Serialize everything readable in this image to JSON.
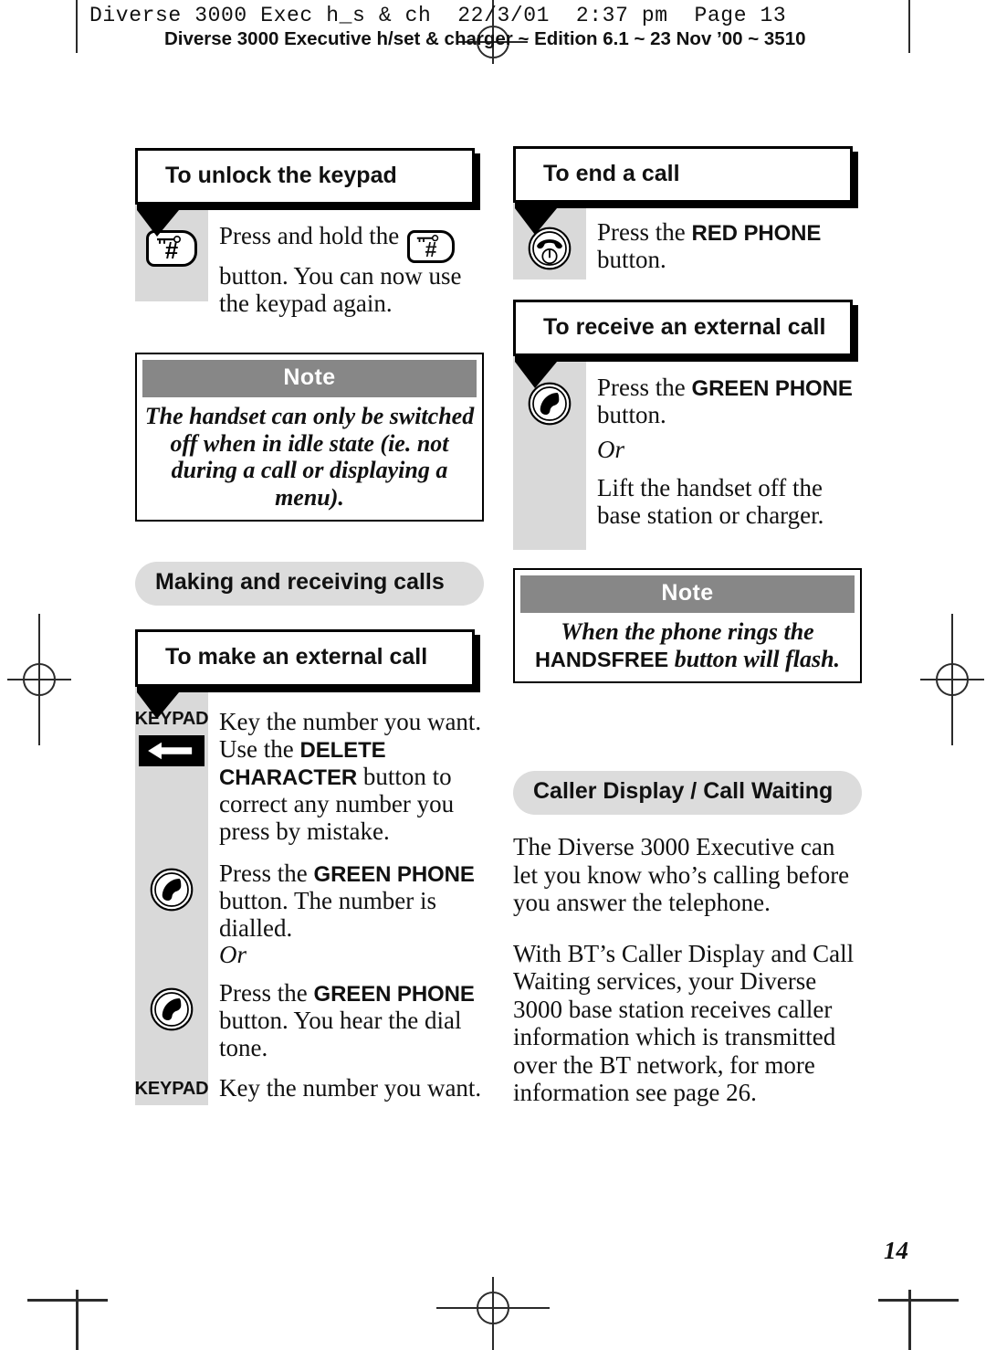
{
  "header": {
    "mono_line": "Diverse 3000 Exec h_s & ch  22/3/01  2:37 pm  Page 13",
    "sans_line": "Diverse 3000 Executive h/set & charger ~ Edition 6.1 ~ 23 Nov ’00 ~ 3510"
  },
  "left_column": {
    "unlock": {
      "heading": "To unlock the keypad",
      "step_text_a": "Press and hold the ",
      "step_text_b": " button. You can now use the keypad again."
    },
    "note": {
      "label": "Note",
      "body": "The handset can only be switched off when in idle state (ie. not during a call or displaying a menu)."
    },
    "section_pill": "Making and receiving calls",
    "make_call": {
      "heading": "To make an external call",
      "keypad_label_1": "KEYPAD",
      "step1_a": "Key the number you want. Use the ",
      "step1_bold1": "DELETE CHARACTER",
      "step1_b": " button to correct any number you press by mistake.",
      "step2_a": "Press the ",
      "step2_bold": "GREEN PHONE",
      "step2_b": " button. The number is dialled.",
      "or": "Or",
      "step3_a": "Press the ",
      "step3_bold": "GREEN PHONE",
      "step3_b": " button. You hear the dial tone.",
      "keypad_label_2": "KEYPAD",
      "step4": "Key the number you want."
    }
  },
  "right_column": {
    "end_call": {
      "heading": "To end a call",
      "step_a": "Press the ",
      "step_bold": "RED PHONE",
      "step_b": " button."
    },
    "receive_call": {
      "heading": "To receive an external call",
      "step1_a": "Press the ",
      "step1_bold": "GREEN PHONE",
      "step1_b": " button.",
      "or": "Or",
      "step2": "Lift the handset off the base station or charger."
    },
    "note": {
      "label": "Note",
      "body_a": "When the phone rings the ",
      "body_bold": "HANDSFREE",
      "body_b": " button will flash."
    },
    "caller_display": {
      "pill": "Caller Display / Call Waiting",
      "para1": "The Diverse 3000 Executive can let you know who’s calling before you answer the telephone.",
      "para2": "With BT’s Caller Display and Call Waiting services, your Diverse 3000 base station receives caller information which is transmitted over the BT network, for more information see page 26."
    }
  },
  "footer": {
    "page_number": "14"
  },
  "icons": {
    "hash_button": "hash-key-button-icon",
    "green_phone": "green-phone-icon",
    "red_phone": "red-phone-icon",
    "delete_character": "delete-character-arrow-icon"
  },
  "colors": {
    "gutter_grey": "#d9d9d9",
    "note_bar_grey": "#878787",
    "pill_grey": "#dcdcdc",
    "ink": "#111111"
  }
}
